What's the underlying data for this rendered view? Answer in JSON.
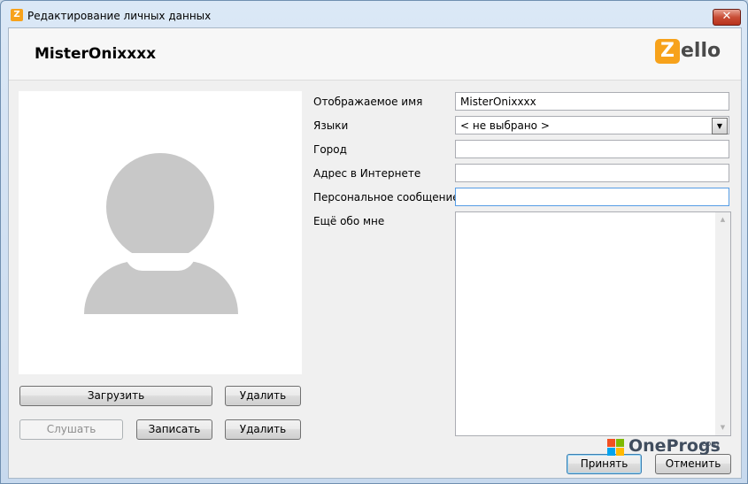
{
  "window": {
    "title": "Редактирование личных данных",
    "app_icon_letter": "Z",
    "close_label": "✕"
  },
  "header": {
    "username": "MisterOnixxxx",
    "logo": {
      "z": "Z",
      "rest": "ello",
      "name": "zello-logo"
    }
  },
  "photo_buttons": {
    "upload": "Загрузить",
    "delete_photo": "Удалить",
    "listen": "Слушать",
    "record": "Записать",
    "delete_audio": "Удалить"
  },
  "form": {
    "display_name_label": "Отображаемое имя",
    "display_name_value": "MisterOnixxxx",
    "languages_label": "Языки",
    "languages_value": "< не выбрано >",
    "city_label": "Город",
    "city_value": "",
    "website_label": "Адрес в Интернете",
    "website_value": "",
    "status_label": "Персональное сообщение",
    "status_value": "",
    "about_label": "Ещё обо мне",
    "about_value": ""
  },
  "dialog_buttons": {
    "accept": "Принять",
    "cancel": "Отменить"
  },
  "watermark": {
    "text": "OneProgs",
    "suffix": ".com"
  },
  "colors": {
    "zello_orange": "#f7a21b",
    "avatar_gray": "#c8c8c8"
  }
}
